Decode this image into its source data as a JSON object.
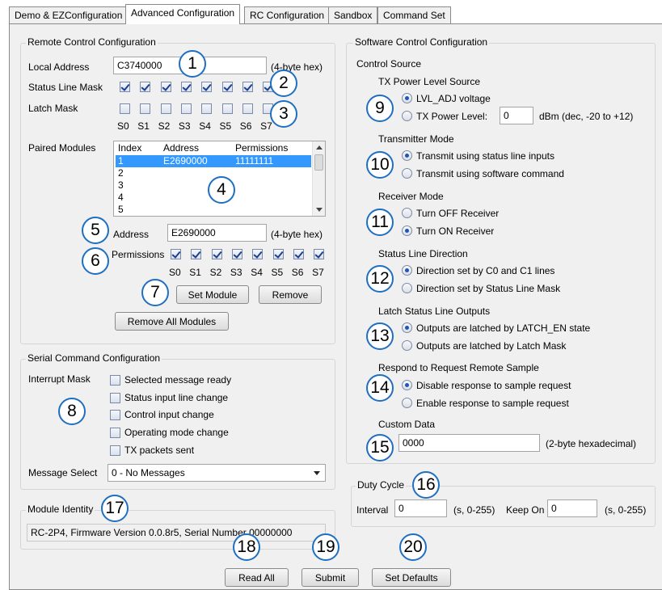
{
  "tabs": [
    "Demo & EZConfiguration",
    "Advanced Configuration",
    "RC Configuration",
    "Sandbox",
    "Command Set"
  ],
  "remote": {
    "title": "Remote Control Configuration",
    "local_address_label": "Local Address",
    "local_address_value": "C3740000",
    "local_address_hint": "(4-byte hex)",
    "status_line_mask_label": "Status Line Mask",
    "status_line_mask": [
      true,
      true,
      true,
      true,
      true,
      true,
      true,
      true
    ],
    "latch_mask_label": "Latch Mask",
    "latch_mask": [
      false,
      false,
      false,
      false,
      false,
      false,
      false,
      false
    ],
    "bits": [
      "S0",
      "S1",
      "S2",
      "S3",
      "S4",
      "S5",
      "S6",
      "S7"
    ],
    "paired_modules_label": "Paired Modules",
    "list_headers": [
      "Index",
      "Address",
      "Permissions"
    ],
    "list_rows": [
      {
        "index": "1",
        "address": "E2690000",
        "permissions": "11111111",
        "selected": true
      },
      {
        "index": "2",
        "address": "",
        "permissions": "",
        "selected": false
      },
      {
        "index": "3",
        "address": "",
        "permissions": "",
        "selected": false
      },
      {
        "index": "4",
        "address": "",
        "permissions": "",
        "selected": false
      },
      {
        "index": "5",
        "address": "",
        "permissions": "",
        "selected": false
      }
    ],
    "address_label": "Address",
    "address_value": "E2690000",
    "address_hint": "(4-byte hex)",
    "permissions_label": "Permissions",
    "permissions": [
      true,
      true,
      true,
      true,
      true,
      true,
      true,
      true
    ],
    "set_module": "Set Module",
    "remove": "Remove",
    "remove_all": "Remove All Modules"
  },
  "serial": {
    "title": "Serial Command Configuration",
    "interrupt_mask_label": "Interrupt Mask",
    "options": [
      {
        "label": "Selected message ready",
        "checked": false
      },
      {
        "label": "Status input line change",
        "checked": false
      },
      {
        "label": "Control input change",
        "checked": false
      },
      {
        "label": "Operating mode change",
        "checked": false
      },
      {
        "label": "TX packets sent",
        "checked": false
      }
    ],
    "message_select_label": "Message Select",
    "message_select_value": "0 - No Messages"
  },
  "identity": {
    "title": "Module Identity",
    "value": "RC-2P4, Firmware Version 0.0.8r5, Serial Number 00000000"
  },
  "software": {
    "title": "Software Control Configuration",
    "control_source": "Control Source",
    "tx_power_title": "TX Power Level Source",
    "tx_opt1": "LVL_ADJ voltage",
    "tx_opt2": "TX Power Level:",
    "tx_value": "0",
    "tx_hint": "dBm (dec, -20 to +12)",
    "tm_title": "Transmitter Mode",
    "tm_opt1": "Transmit using status line inputs",
    "tm_opt2": "Transmit using software command",
    "rm_title": "Receiver Mode",
    "rm_opt1": "Turn OFF Receiver",
    "rm_opt2": "Turn ON Receiver",
    "sld_title": "Status Line Direction",
    "sld_opt1": "Direction set by C0 and C1 lines",
    "sld_opt2": "Direction set by Status Line Mask",
    "latch_title": "Latch Status Line Outputs",
    "latch_opt1": "Outputs are latched by LATCH_EN state",
    "latch_opt2": "Outputs are latched by Latch Mask",
    "resp_title": "Respond to Request Remote Sample",
    "resp_opt1": "Disable response to sample request",
    "resp_opt2": "Enable response to sample request",
    "custom_title": "Custom Data",
    "custom_value": "0000",
    "custom_hint": "(2-byte hexadecimal)"
  },
  "duty": {
    "title": "Duty Cycle",
    "interval_label": "Interval",
    "interval_value": "0",
    "interval_hint": "(s, 0-255)",
    "keep_label": "Keep On",
    "keep_value": "0",
    "keep_hint": "(s, 0-255)"
  },
  "buttons": {
    "read_all": "Read All",
    "submit": "Submit",
    "set_defaults": "Set Defaults"
  },
  "badges": [
    "1",
    "2",
    "3",
    "4",
    "5",
    "6",
    "7",
    "8",
    "9",
    "10",
    "11",
    "12",
    "13",
    "14",
    "15",
    "16",
    "17",
    "18",
    "19",
    "20"
  ],
  "colors": {
    "badge_border": "#1f6fc1",
    "selection": "#3399ff",
    "radio_dot": "#1f55b5"
  }
}
